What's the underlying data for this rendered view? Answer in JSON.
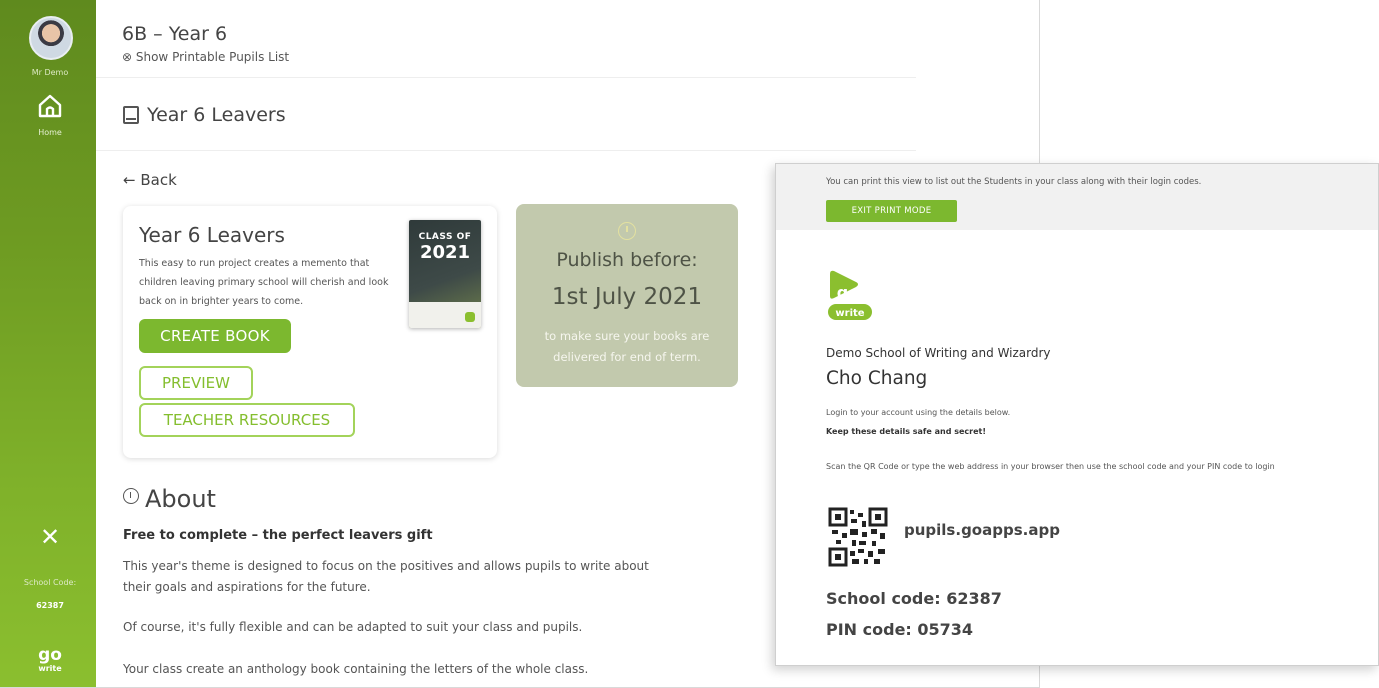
{
  "sidebar": {
    "user_name": "Mr Demo",
    "home_label": "Home",
    "school_code_label": "School Code:",
    "school_code_value": "62387"
  },
  "header": {
    "class_title": "6B – Year 6",
    "printable_link": "⊗ Show Printable Pupils List"
  },
  "project": {
    "heading": "Year 6 Leavers",
    "back_label": "← Back",
    "card": {
      "title": "Year 6 Leavers",
      "description": "This easy to run project creates a memento that children leaving primary school will cherish and look back on in brighter years to come.",
      "cover_line1": "CLASS OF",
      "cover_line2": "2021",
      "create_label": "CREATE BOOK",
      "preview_label": "PREVIEW",
      "teacher_label": "TEACHER RESOURCES"
    },
    "publish": {
      "label": "Publish before:",
      "date": "1st July 2021",
      "note": "to make sure your books are delivered for end of term."
    }
  },
  "about": {
    "heading": "About",
    "subtitle": "Free to complete – the perfect leavers gift",
    "p1": "This year's theme is designed to focus on the positives and allows pupils to write about their goals and aspirations for the future.",
    "p2": "Of course, it's fully flexible and can be adapted to suit your class and pupils.",
    "p3": "Your class create an anthology book containing the letters of the whole class."
  },
  "print_view": {
    "instruction": "You can print this view to list out the Students in your class along with their login codes.",
    "exit_label": "EXIT PRINT MODE",
    "school_name": "Demo School of Writing and Wizardry",
    "pupil_name": "Cho Chang",
    "login_text": "Login to your account using the details below.",
    "keep_text": "Keep these details safe and secret!",
    "scan_text": "Scan the QR Code or type the web address in your browser then use the school code and your PIN code to login",
    "url": "pupils.goapps.app",
    "school_code": "School code: 62387",
    "pin_code": "PIN code: 05734"
  },
  "colors": {
    "brand_green": "#7cb82f",
    "sidebar_dark": "#5f8a1e",
    "publish_card": "#c2c9ad"
  },
  "icons": [
    "home-icon",
    "close-icon",
    "book-icon",
    "clock-icon",
    "info-icon",
    "qr-code-icon",
    "go-write-logo"
  ]
}
